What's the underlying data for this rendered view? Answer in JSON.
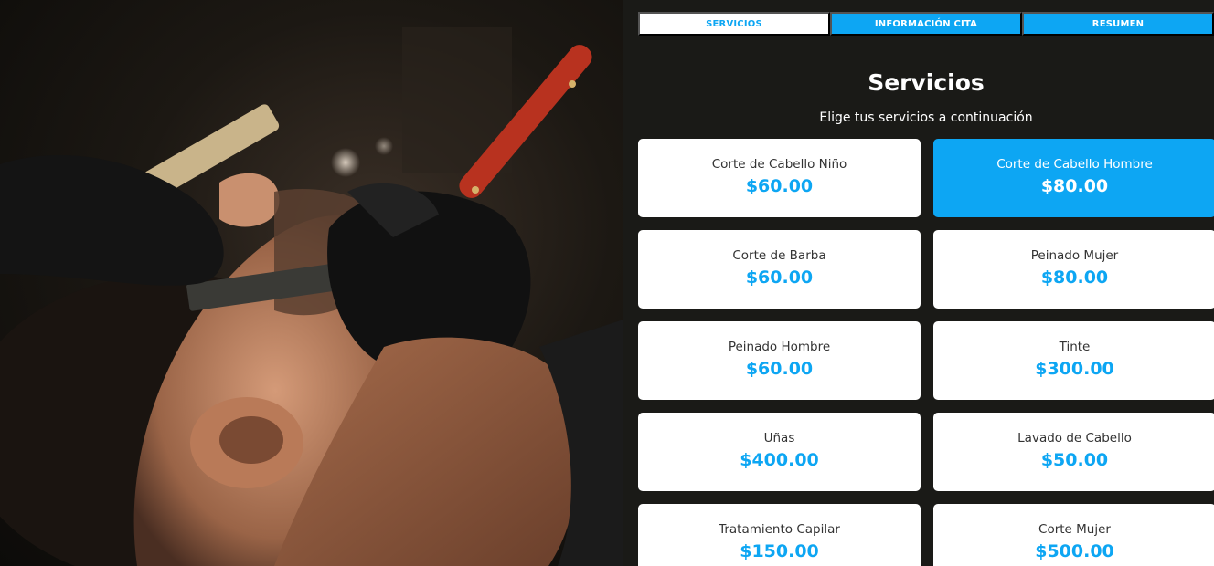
{
  "hero": {
    "image_icon": "barber-shaving-photo"
  },
  "tabs": [
    {
      "label": "Servicios",
      "active": true
    },
    {
      "label": "Información Cita",
      "active": false
    },
    {
      "label": "Resumen",
      "active": false
    }
  ],
  "section": {
    "title": "Servicios",
    "subtitle": "Elige tus servicios a continuación"
  },
  "services": [
    {
      "name": "Corte de Cabello Niño",
      "price": "$60.00",
      "selected": false
    },
    {
      "name": "Corte de Cabello Hombre",
      "price": "$80.00",
      "selected": true
    },
    {
      "name": "Corte de Barba",
      "price": "$60.00",
      "selected": false
    },
    {
      "name": "Peinado Mujer",
      "price": "$80.00",
      "selected": false
    },
    {
      "name": "Peinado Hombre",
      "price": "$60.00",
      "selected": false
    },
    {
      "name": "Tinte",
      "price": "$300.00",
      "selected": false
    },
    {
      "name": "Uñas",
      "price": "$400.00",
      "selected": false
    },
    {
      "name": "Lavado de Cabello",
      "price": "$50.00",
      "selected": false
    },
    {
      "name": "Tratamiento Capilar",
      "price": "$150.00",
      "selected": false
    },
    {
      "name": "Corte Mujer",
      "price": "$500.00",
      "selected": false
    }
  ],
  "colors": {
    "accent": "#0da6f3",
    "background": "#1a1a17",
    "card": "#ffffff"
  }
}
